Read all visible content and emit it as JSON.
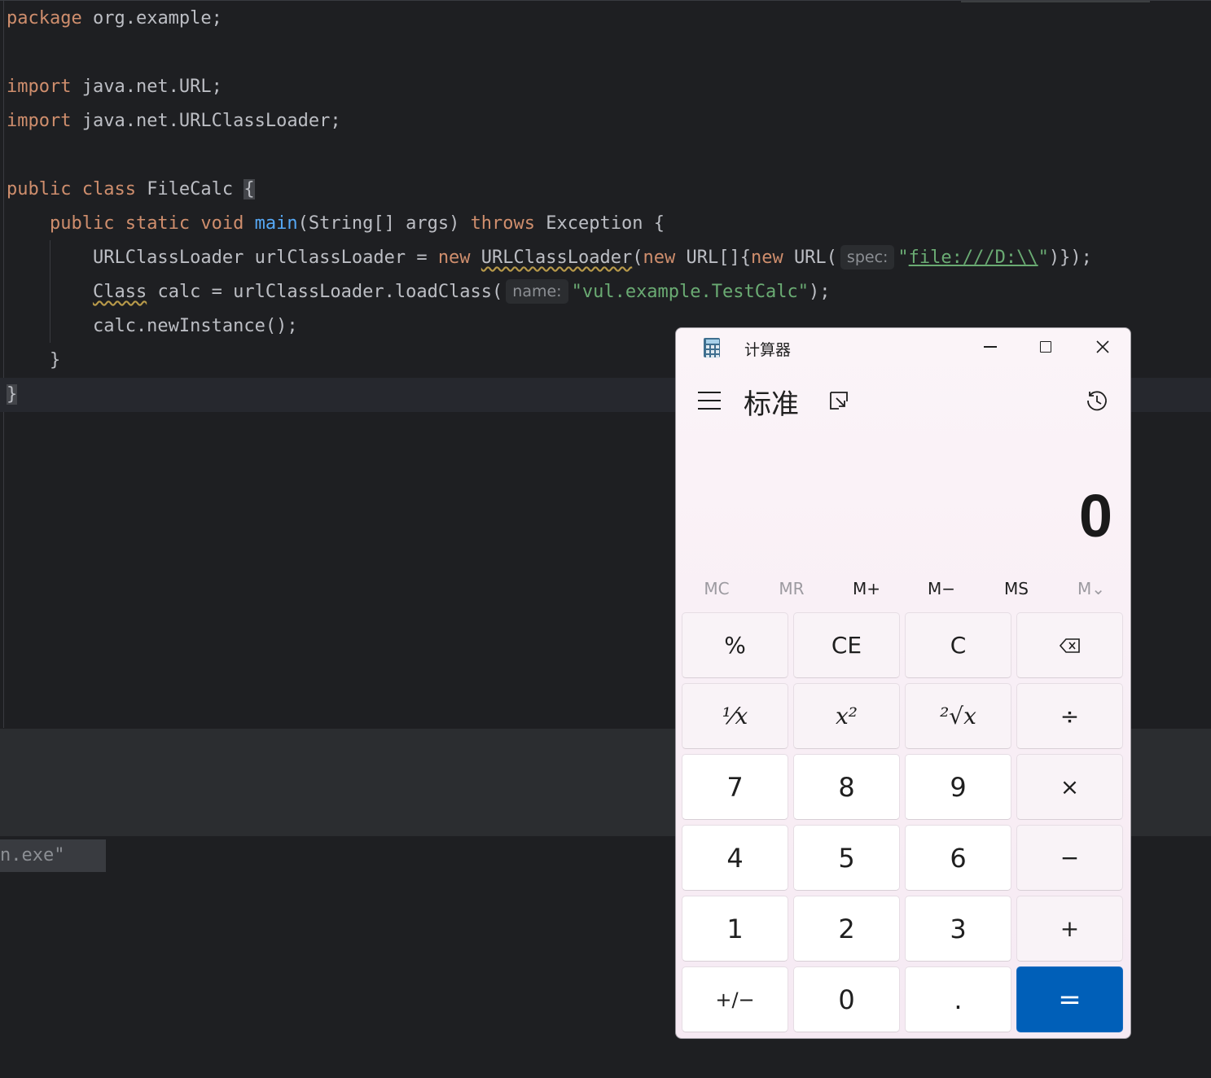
{
  "editor": {
    "lines": [
      {
        "segments": [
          [
            "kw",
            "package "
          ],
          [
            "p",
            "org.example;"
          ]
        ]
      },
      {
        "segments": []
      },
      {
        "segments": [
          [
            "kw",
            "import "
          ],
          [
            "p",
            "java.net.URL;"
          ]
        ]
      },
      {
        "segments": [
          [
            "kw",
            "import "
          ],
          [
            "p",
            "java.net.URLClassLoader;"
          ]
        ]
      },
      {
        "segments": []
      },
      {
        "segments": [
          [
            "kw",
            "public class "
          ],
          [
            "p",
            "FileCalc "
          ],
          [
            "brace",
            "{"
          ]
        ]
      },
      {
        "segments": [
          [
            "p",
            "    "
          ],
          [
            "kw",
            "public static void "
          ],
          [
            "fn",
            "main"
          ],
          [
            "p",
            "(String[] args) "
          ],
          [
            "kw",
            "throws "
          ],
          [
            "p",
            "Exception {"
          ]
        ]
      },
      {
        "segments": [
          [
            "p",
            "        URLClassLoader urlClassLoader = "
          ],
          [
            "kw",
            "new "
          ],
          [
            "err",
            "URLClassLoader"
          ],
          [
            "p",
            "("
          ],
          [
            "kw",
            "new "
          ],
          [
            "p",
            "URL[]{"
          ],
          [
            "kw",
            "new "
          ],
          [
            "p",
            "URL("
          ],
          [
            "hint",
            "spec:"
          ],
          [
            "str",
            "\""
          ],
          [
            "link",
            "file:///D:\\\\"
          ],
          [
            "str",
            "\""
          ],
          [
            "p",
            ")});"
          ]
        ]
      },
      {
        "segments": [
          [
            "p",
            "        "
          ],
          [
            "err",
            "Class"
          ],
          [
            "p",
            " calc = urlClassLoader.loadClass("
          ],
          [
            "hint",
            "name:"
          ],
          [
            "str",
            "\"vul.example.TestCalc\""
          ],
          [
            "p",
            ");"
          ]
        ]
      },
      {
        "segments": [
          [
            "p",
            "        calc.newInstance();"
          ]
        ]
      },
      {
        "segments": [
          [
            "p",
            "    }"
          ]
        ]
      },
      {
        "segments": [
          [
            "brace",
            "}"
          ]
        ],
        "current": true
      }
    ]
  },
  "console": {
    "command_text": "n.exe\" ..."
  },
  "calculator": {
    "window_title": "计算器",
    "mode_title": "标准",
    "display_value": "0",
    "memory_buttons": [
      {
        "label": "MC",
        "enabled": false
      },
      {
        "label": "MR",
        "enabled": false
      },
      {
        "label": "M+",
        "enabled": true
      },
      {
        "label": "M−",
        "enabled": true
      },
      {
        "label": "MS",
        "enabled": true
      },
      {
        "label": "M⌄",
        "enabled": false
      }
    ],
    "keys": {
      "percent": "%",
      "ce": "CE",
      "c": "C",
      "backspace": "⌫",
      "reciprocal": "⅟x",
      "square": "x²",
      "sqrt": "²√x",
      "divide": "÷",
      "seven": "7",
      "eight": "8",
      "nine": "9",
      "multiply": "×",
      "four": "4",
      "five": "5",
      "six": "6",
      "minus": "−",
      "one": "1",
      "two": "2",
      "three": "3",
      "plus": "+",
      "negate": "+/−",
      "zero": "0",
      "decimal": ".",
      "equals": "="
    },
    "accent_color": "#005fb8"
  }
}
